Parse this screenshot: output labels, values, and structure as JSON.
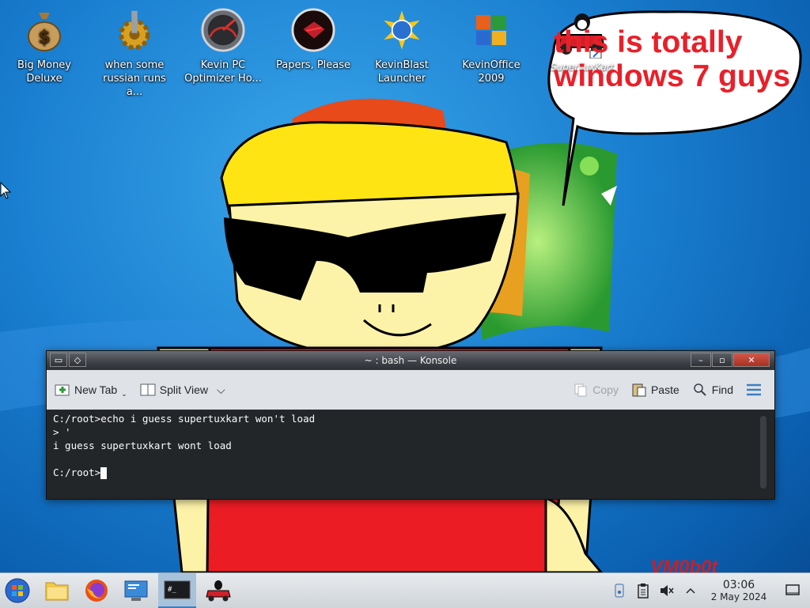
{
  "desktop": {
    "icons": [
      {
        "label": "Big Money\nDeluxe",
        "icon": "money-bag-icon"
      },
      {
        "label": "when some\nrussian runs a...",
        "icon": "gear-icon"
      },
      {
        "label": "Kevin PC\nOptimizer Ho...",
        "icon": "speedometer-icon"
      },
      {
        "label": "Papers, Please",
        "icon": "papers-please-icon"
      },
      {
        "label": "KevinBlast\nLauncher",
        "icon": "globe-burst-icon"
      },
      {
        "label": "KevinOffice\n2009",
        "icon": "office-icon"
      }
    ],
    "shortcut_label": "SuperTuxKart",
    "speech_bubble": "this is totally\nwindows 7 guys",
    "signature": "VM0b0t"
  },
  "konsole": {
    "title": "~ : bash — Konsole",
    "toolbar": {
      "new_tab": "New Tab",
      "split_view": "Split View",
      "copy": "Copy",
      "paste": "Paste",
      "find": "Find"
    },
    "lines": [
      "C:/root>echo i guess supertuxkart won't load",
      "> '",
      "i guess supertuxkart wont load",
      "",
      "C:/root>"
    ]
  },
  "taskbar": {
    "apps": [
      "start-menu-icon",
      "file-manager-icon",
      "firefox-icon",
      "system-settings-icon",
      "konsole-icon",
      "supertuxkart-icon"
    ],
    "clock": {
      "time": "03:06",
      "date": "2 May 2024"
    }
  },
  "colors": {
    "speech_text": "#e8202a",
    "terminal_bg": "#232629",
    "accent": "#3d7ec2"
  }
}
